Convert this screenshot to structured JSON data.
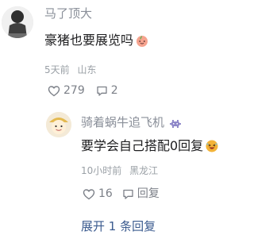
{
  "comment": {
    "author": "马了顶大",
    "text": "豪猪也要展览吗",
    "emoji": "peach-emoji",
    "time": "5天前",
    "location": "山东",
    "likes": "279",
    "replies": "2"
  },
  "reply": {
    "author": "骑着蜗牛追飞机",
    "author_badge": "alien-invader-badge",
    "text": "要学会自己搭配0回复",
    "emoji": "laughing-face-emoji",
    "time": "10小时前",
    "location": "黑龙江",
    "likes": "16",
    "reply_label": "回复"
  },
  "expand": {
    "label": "展开 1 条回复"
  },
  "colors": {
    "name": "#8a8f99",
    "meta": "#9aa0a6",
    "link": "#3b5b8f",
    "badge": "#8f88c9"
  }
}
